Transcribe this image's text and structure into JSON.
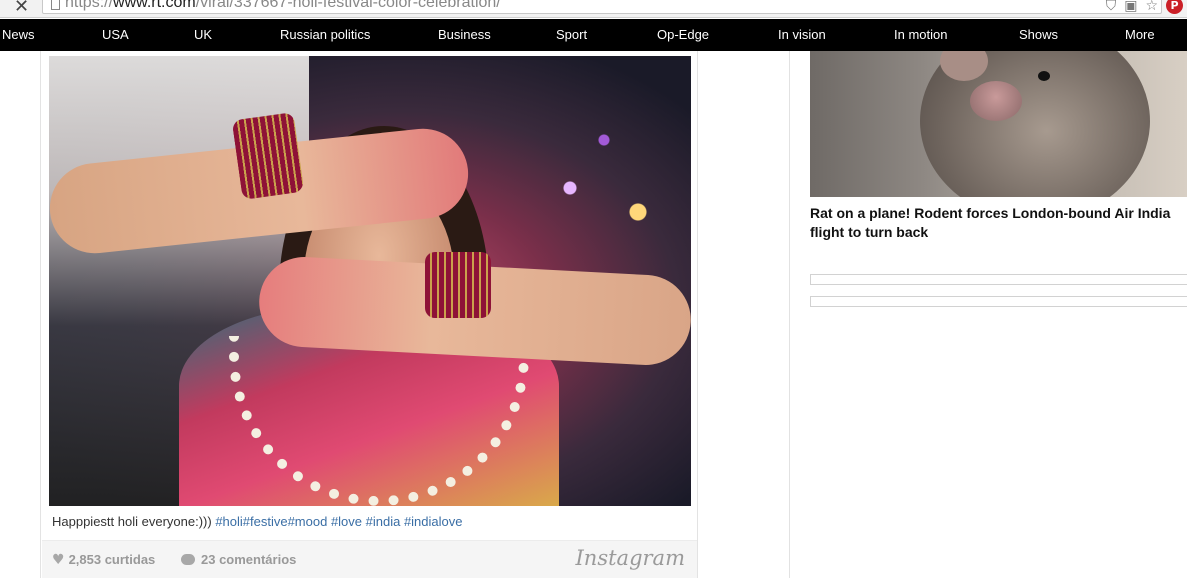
{
  "browser": {
    "url_prefix": "https://",
    "url_host": "www.rt.com",
    "url_path": "/viral/337667-holi-festival-color-celebration/",
    "pinterest_label": "P"
  },
  "nav": {
    "items": [
      {
        "label": "News"
      },
      {
        "label": "USA"
      },
      {
        "label": "UK"
      },
      {
        "label": "Russian politics"
      },
      {
        "label": "Business"
      },
      {
        "label": "Sport"
      },
      {
        "label": "Op-Edge"
      },
      {
        "label": "In vision"
      },
      {
        "label": "In motion"
      },
      {
        "label": "Shows"
      },
      {
        "label": "More"
      }
    ]
  },
  "instagram_post": {
    "caption_text": "Happpiestt holi everyone:))) ",
    "caption_tags": "#holi#festive#mood #love #india #indialove",
    "likes": "2,853 curtidas",
    "comments": "23 comentários",
    "logo": "Instagram"
  },
  "sidebar": {
    "story_headline": "Rat on a plane! Rodent forces London-bound Air India flight to turn back"
  }
}
